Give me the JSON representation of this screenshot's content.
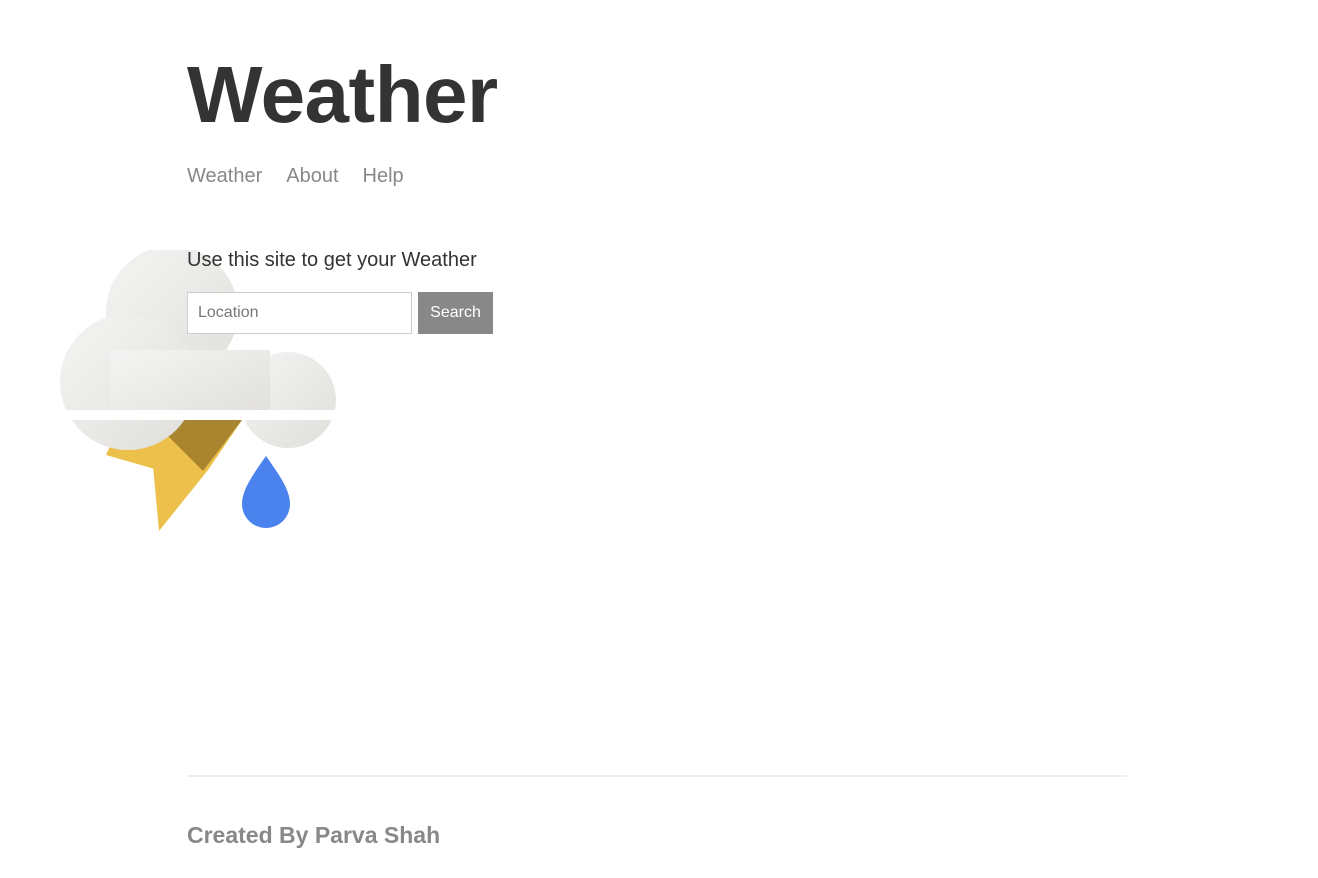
{
  "header": {
    "title": "Weather"
  },
  "nav": {
    "items": [
      {
        "label": "Weather"
      },
      {
        "label": "About"
      },
      {
        "label": "Help"
      }
    ]
  },
  "main": {
    "intro": "Use this site to get your Weather",
    "search": {
      "placeholder": "Location",
      "value": "",
      "button_label": "Search"
    },
    "illustration_icon": "thunderstorm-rain-icon"
  },
  "footer": {
    "credit": "Created By Parva Shah"
  },
  "colors": {
    "title": "#333333",
    "nav_link": "#888888",
    "button_bg": "#888888",
    "button_text": "#ffffff",
    "cloud": "#e6e5e2",
    "bolt_light": "#ecc04a",
    "bolt_dark": "#a8852e",
    "raindrop": "#4a82ee"
  }
}
